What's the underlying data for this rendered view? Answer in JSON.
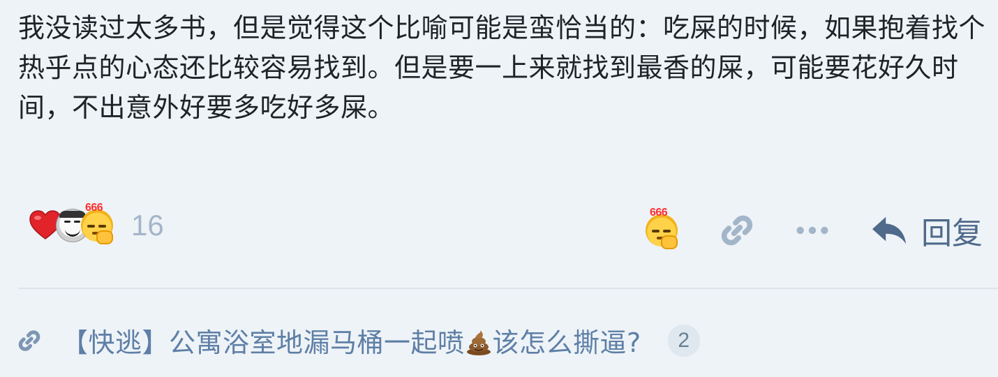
{
  "post": {
    "text": "我没读过太多书，但是觉得这个比喻可能是蛮恰当的：吃屎的时候，如果抱着找个热乎点的心态还比较容易找到。但是要一上来就找到最香的屎，可能要花好久时间，不出意外好要多吃好多屎。"
  },
  "reactions": {
    "items": [
      "heart",
      "meme-face",
      "smug-666-face"
    ],
    "badge_text": "666",
    "count": "16"
  },
  "actions": {
    "react_badge_text": "666",
    "reply_label": "回复"
  },
  "related_topic": {
    "title_before_emoji": "【快逃】公寓浴室地漏马桶一起喷",
    "title_after_emoji": "该怎么撕逼?",
    "count": "2"
  },
  "colors": {
    "background": "#eef3f7",
    "body_text": "#1f2328",
    "muted_blue": "#a3b5c9",
    "link_blue": "#5e7fa6",
    "reply_blue": "#4f6a8a",
    "badge_red": "#ff2d2d"
  }
}
